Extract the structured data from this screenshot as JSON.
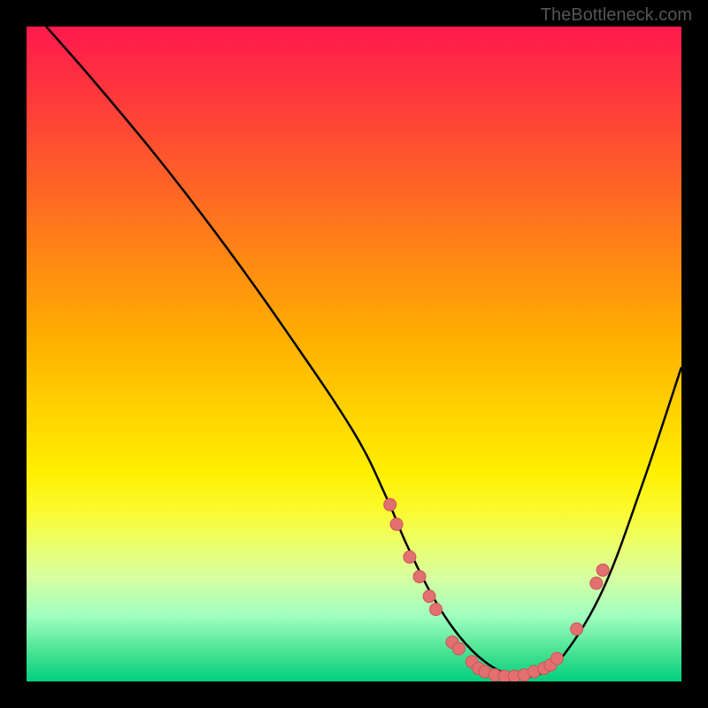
{
  "watermark": "TheBottleneck.com",
  "colors": {
    "background": "#000000",
    "gradient_top": "#ff1a4d",
    "gradient_bottom": "#00d080",
    "curve": "#000000",
    "dot_fill": "#e27070",
    "dot_stroke": "#cc5555"
  },
  "chart_data": {
    "type": "line",
    "title": "",
    "xlabel": "",
    "ylabel": "",
    "xlim": [
      0,
      100
    ],
    "ylim": [
      0,
      100
    ],
    "curve": {
      "x": [
        3,
        10,
        20,
        30,
        40,
        50,
        55,
        58,
        62,
        66,
        70,
        74,
        78,
        82,
        88,
        94,
        100
      ],
      "y": [
        100,
        92,
        80,
        67,
        53,
        38,
        28,
        21,
        13,
        7,
        3,
        1,
        1,
        4,
        14,
        30,
        48
      ]
    },
    "dots": [
      {
        "x": 55.5,
        "y": 27
      },
      {
        "x": 56.5,
        "y": 24
      },
      {
        "x": 58.5,
        "y": 19
      },
      {
        "x": 60.0,
        "y": 16
      },
      {
        "x": 61.5,
        "y": 13
      },
      {
        "x": 62.5,
        "y": 11
      },
      {
        "x": 65.0,
        "y": 6
      },
      {
        "x": 66.0,
        "y": 5
      },
      {
        "x": 68.0,
        "y": 3
      },
      {
        "x": 69.0,
        "y": 2
      },
      {
        "x": 70.0,
        "y": 1.5
      },
      {
        "x": 71.5,
        "y": 1
      },
      {
        "x": 73.0,
        "y": 0.8
      },
      {
        "x": 74.5,
        "y": 0.8
      },
      {
        "x": 76.0,
        "y": 1
      },
      {
        "x": 77.5,
        "y": 1.5
      },
      {
        "x": 79.0,
        "y": 2
      },
      {
        "x": 80.0,
        "y": 2.5
      },
      {
        "x": 81.0,
        "y": 3.5
      },
      {
        "x": 84.0,
        "y": 8
      },
      {
        "x": 87.0,
        "y": 15
      },
      {
        "x": 88.0,
        "y": 17
      }
    ]
  }
}
